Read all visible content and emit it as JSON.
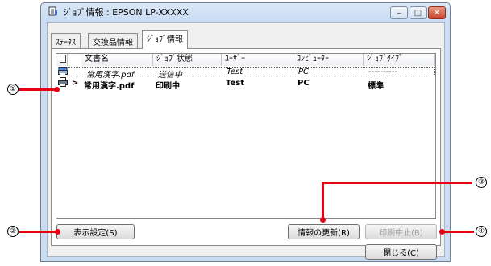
{
  "window": {
    "title": "ｼﾞｮﾌﾞ情報 : EPSON LP-XXXXX",
    "controls": {
      "minimize": "–",
      "maximize": "□",
      "close": "✕"
    }
  },
  "tabs": [
    {
      "label": "ｽﾃｰﾀｽ"
    },
    {
      "label": "交換品情報"
    },
    {
      "label": "ｼﾞｮﾌﾞ情報"
    }
  ],
  "list": {
    "columns": [
      "文書名",
      "ｼﾞｮﾌﾞ状態",
      "ﾕｰｻﾞｰ",
      "ｺﾝﾋﾟｭｰﾀｰ",
      "ｼﾞｮﾌﾞﾀｲﾌﾟ"
    ],
    "rows": [
      {
        "document": "常用漢字.pdf",
        "status": "送信中",
        "user": "Test",
        "computer": "PC",
        "type": "----------"
      },
      {
        "marker": ">",
        "document": "常用漢字.pdf",
        "status": "印刷中",
        "user": "Test",
        "computer": "PC",
        "type": "標準"
      }
    ]
  },
  "buttons": {
    "display_settings": "表示設定(S)",
    "refresh": "情報の更新(R)",
    "cancel_print": "印刷中止(B)",
    "close": "閉じる(C)"
  },
  "callouts": [
    "①",
    "②",
    "③",
    "④"
  ],
  "colors": {
    "callout": "#e60012",
    "titlebar": "#c9dcf2",
    "close": "#c7432a"
  }
}
